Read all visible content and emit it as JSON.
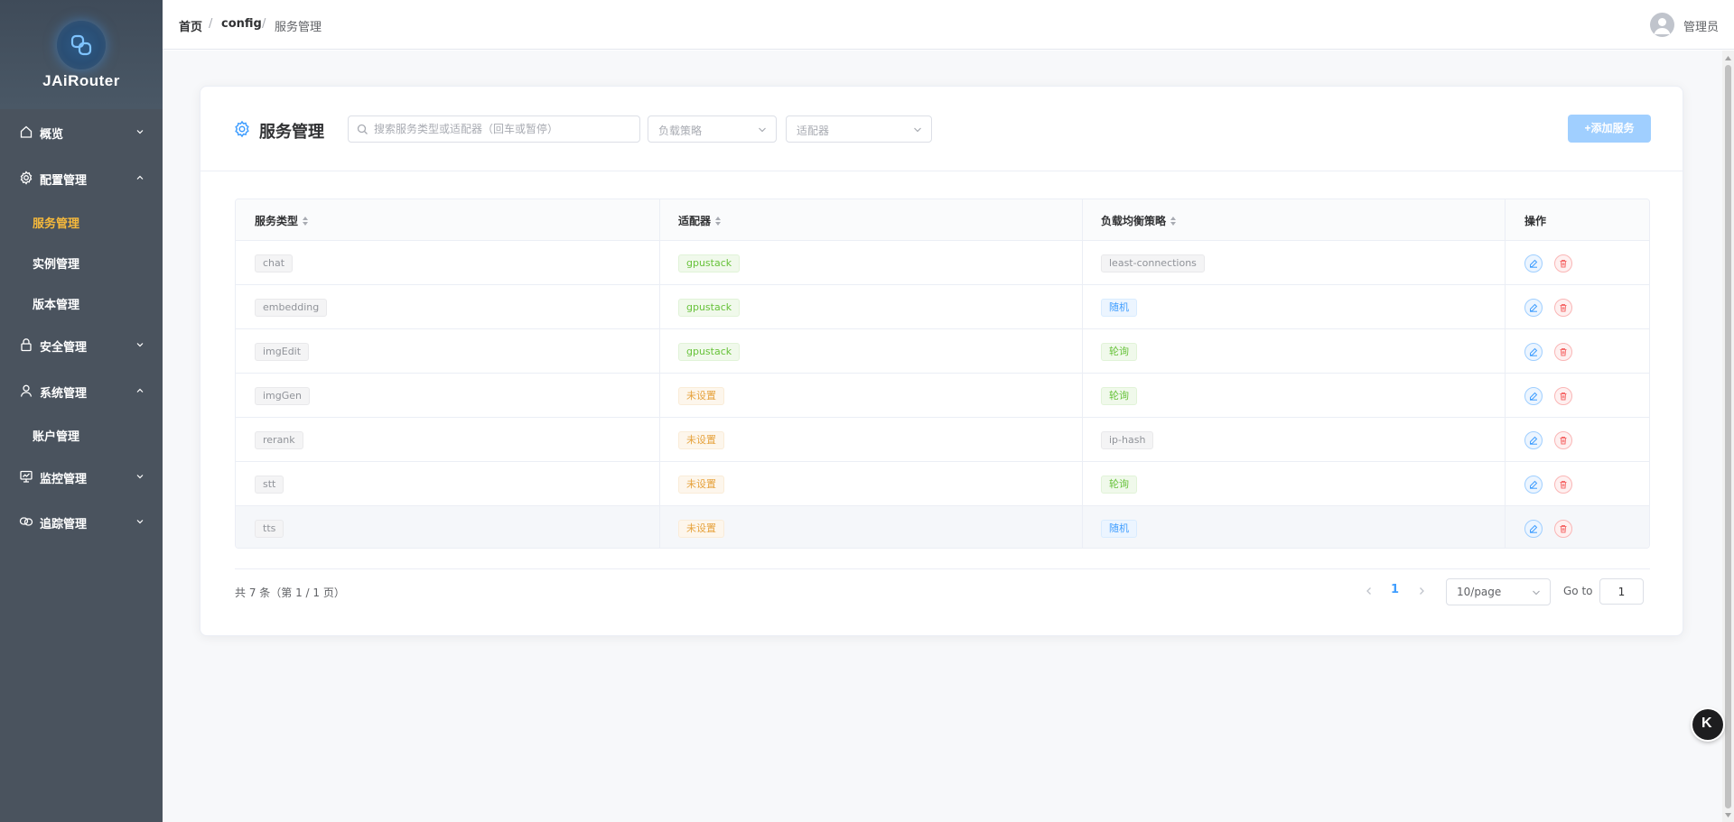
{
  "app": {
    "title": "JAiRouter"
  },
  "sidebar": {
    "groups": [
      {
        "label": "概览",
        "icon": "home-icon",
        "expanded": false
      },
      {
        "label": "配置管理",
        "icon": "gear-icon",
        "expanded": true
      },
      {
        "label": "安全管理",
        "icon": "lock-icon",
        "expanded": false
      },
      {
        "label": "系统管理",
        "icon": "user-icon",
        "expanded": true
      },
      {
        "label": "监控管理",
        "icon": "monitor-icon",
        "expanded": false
      },
      {
        "label": "追踪管理",
        "icon": "link-icon",
        "expanded": false
      }
    ],
    "sub": {
      "service": "服务管理",
      "instance": "实例管理",
      "version": "版本管理",
      "account": "账户管理"
    },
    "active": "服务管理"
  },
  "breadcrumb": {
    "home": "首页",
    "section": "config",
    "current": "服务管理",
    "sep": "/"
  },
  "user": {
    "name": "管理员"
  },
  "page": {
    "title": "服务管理",
    "search_placeholder": "搜索服务类型或适配器（回车或暂停）",
    "filter_strategy_placeholder": "负载策略",
    "filter_adapter_placeholder": "适配器",
    "add_button": "+添加服务"
  },
  "table": {
    "columns": [
      "服务类型",
      "适配器",
      "负载均衡策略",
      "操作"
    ],
    "rows": [
      {
        "service": "chat",
        "adapter": "gpustack",
        "adapter_color": "green",
        "strategy": "least-connections",
        "strategy_color": "gray"
      },
      {
        "service": "embedding",
        "adapter": "gpustack",
        "adapter_color": "green",
        "strategy": "随机",
        "strategy_color": "blue"
      },
      {
        "service": "imgEdit",
        "adapter": "gpustack",
        "adapter_color": "green",
        "strategy": "轮询",
        "strategy_color": "green"
      },
      {
        "service": "imgGen",
        "adapter": "未设置",
        "adapter_color": "orange",
        "strategy": "轮询",
        "strategy_color": "green"
      },
      {
        "service": "rerank",
        "adapter": "未设置",
        "adapter_color": "orange",
        "strategy": "ip-hash",
        "strategy_color": "gray"
      },
      {
        "service": "stt",
        "adapter": "未设置",
        "adapter_color": "orange",
        "strategy": "轮询",
        "strategy_color": "green"
      },
      {
        "service": "tts",
        "adapter": "未设置",
        "adapter_color": "orange",
        "strategy": "随机",
        "strategy_color": "blue"
      }
    ]
  },
  "pagination": {
    "total_text": "共 7 条（第 1 / 1 页）",
    "current_page": "1",
    "page_size": "10/page",
    "goto_label": "Go to",
    "goto_value": "1"
  },
  "floating_button": {
    "label": "K"
  },
  "colors": {
    "sidebar_bg": "#4a535e",
    "active_menu": "#f6b93b",
    "primary": "#409eff",
    "add_button_bg": "#a0cfff"
  }
}
